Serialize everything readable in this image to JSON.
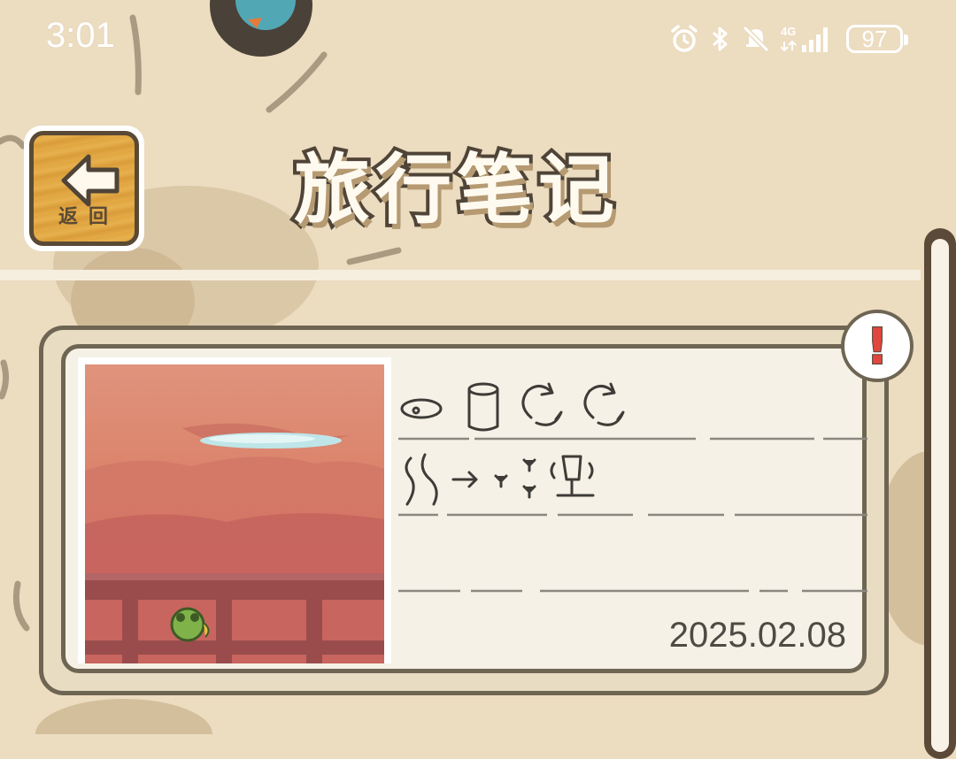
{
  "status_bar": {
    "time": "3:01",
    "network": "4G",
    "battery": "97"
  },
  "header": {
    "back_label": "返回",
    "title": "旅行笔记"
  },
  "note_card": {
    "alert_mark": "!",
    "date": "2025.02.08",
    "photo_icon": "frog-on-railing"
  },
  "colors": {
    "background": "#ecdcc0",
    "card_border": "#6e6553",
    "card_fill": "#f6f1e6",
    "wood": "#dfa53f",
    "alert_red": "#e0473d"
  }
}
